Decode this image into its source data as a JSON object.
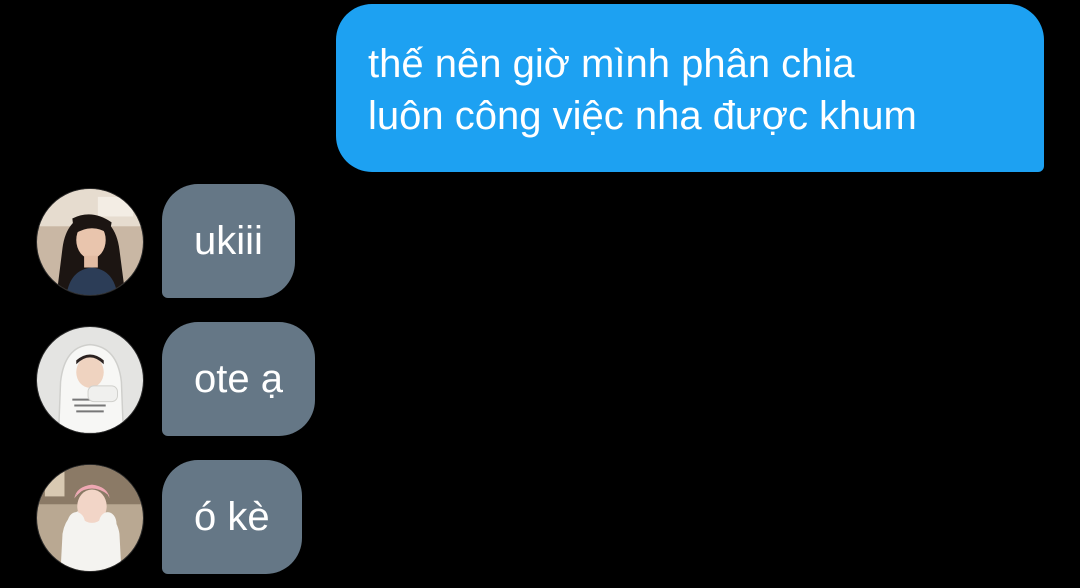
{
  "outgoing": {
    "lines": [
      "thế nên giờ mình phân chia",
      "luôn công việc nha được khum"
    ]
  },
  "incoming": [
    {
      "text": "ukiii",
      "avatar": "avatar-girl-dark-hair"
    },
    {
      "text": "ote ạ",
      "avatar": "avatar-hoodie-white"
    },
    {
      "text": "ó kè",
      "avatar": "avatar-pink-hair"
    }
  ],
  "colors": {
    "background": "#000000",
    "outgoing_bubble": "#1da1f2",
    "incoming_bubble": "#657786",
    "text": "#ffffff"
  }
}
